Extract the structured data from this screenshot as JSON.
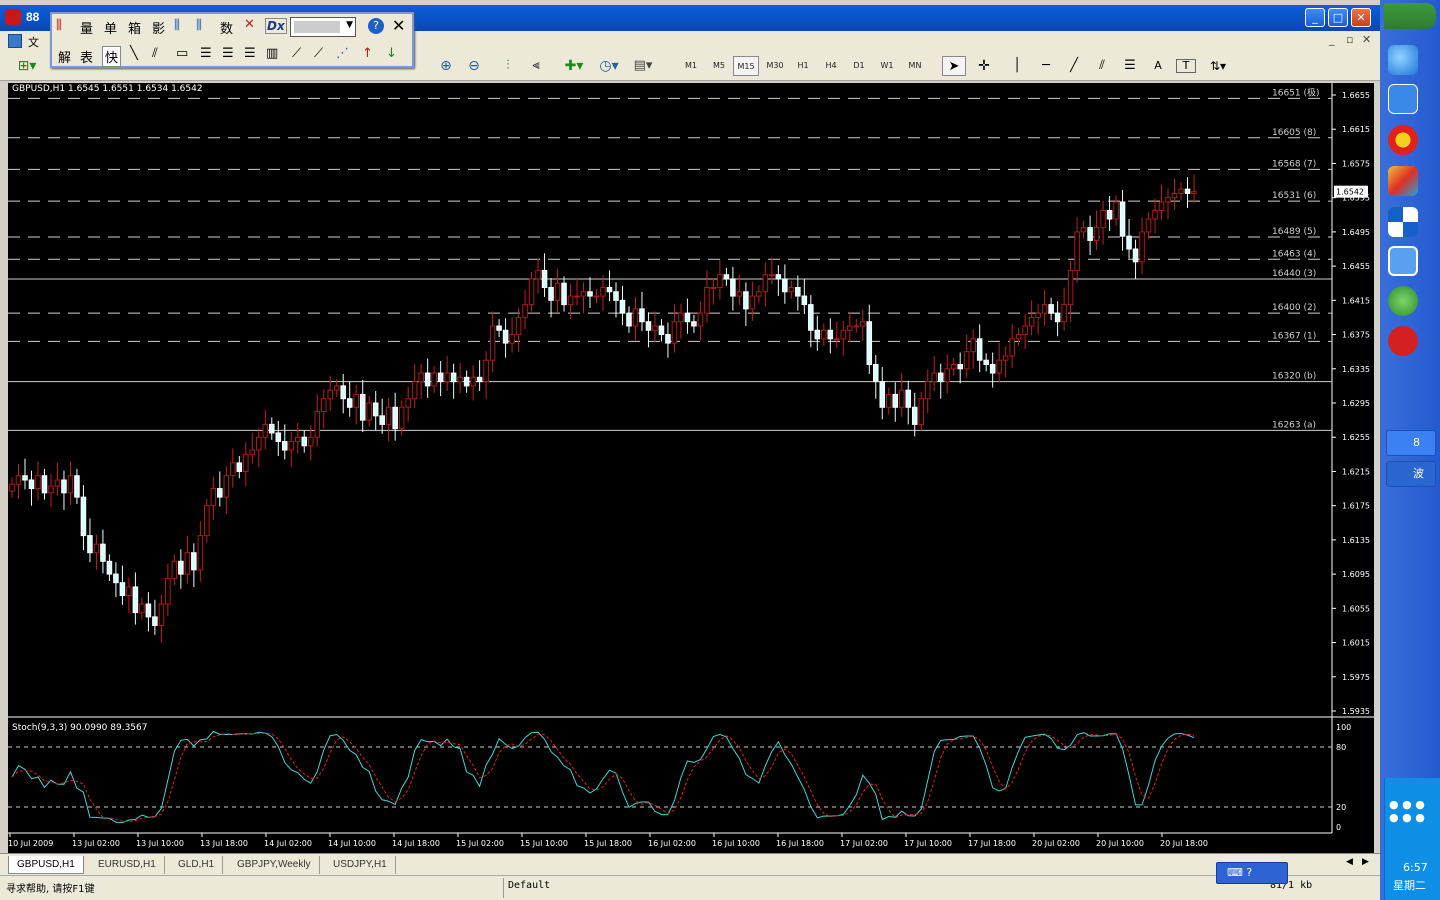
{
  "window": {
    "title": "88"
  },
  "menubar": {
    "items": [
      "文"
    ]
  },
  "float_toolbar": {
    "row1": [
      "量",
      "单",
      "箱",
      "影",
      "数",
      "Dx"
    ],
    "row2": [
      "解",
      "表",
      "快"
    ]
  },
  "toolbar": {
    "timeframes": [
      "M1",
      "M5",
      "M15",
      "M30",
      "H1",
      "H4",
      "D1",
      "W1",
      "MN"
    ],
    "active_timeframe": "M15",
    "tool_labels": [
      "A",
      "T"
    ]
  },
  "chart": {
    "symbol_info": "GBPUSD,H1  1.6545 1.6551 1.6534 1.6542",
    "price_axis": [
      "1.6655",
      "1.6615",
      "1.6575",
      "1.6535",
      "1.6495",
      "1.6455",
      "1.6415",
      "1.6375",
      "1.6335",
      "1.6295",
      "1.6255",
      "1.6215",
      "1.6175",
      "1.6135",
      "1.6095",
      "1.6055",
      "1.6015",
      "1.5975",
      "1.5935"
    ],
    "current_price": "1.6542",
    "levels": [
      {
        "label": "16651 (极)",
        "price": 1.6651,
        "style": "dash"
      },
      {
        "label": "16605 (8)",
        "price": 1.6605,
        "style": "dash"
      },
      {
        "label": "16568 (7)",
        "price": 1.6568,
        "style": "dash"
      },
      {
        "label": "16531 (6)",
        "price": 1.6531,
        "style": "dash"
      },
      {
        "label": "16489 (5)",
        "price": 1.6489,
        "style": "dash"
      },
      {
        "label": "16463 (4)",
        "price": 1.6463,
        "style": "dash"
      },
      {
        "label": "16440 (3)",
        "price": 1.644,
        "style": "solid"
      },
      {
        "label": "16400 (2)",
        "price": 1.64,
        "style": "dash"
      },
      {
        "label": "16367 (1)",
        "price": 1.6367,
        "style": "dash"
      },
      {
        "label": "16320 (b)",
        "price": 1.632,
        "style": "solid"
      },
      {
        "label": "16263 (a)",
        "price": 1.6263,
        "style": "solid"
      }
    ],
    "time_axis": [
      "10 Jul 2009",
      "13 Jul 02:00",
      "13 Jul 10:00",
      "13 Jul 18:00",
      "14 Jul 02:00",
      "14 Jul 10:00",
      "14 Jul 18:00",
      "15 Jul 02:00",
      "15 Jul 10:00",
      "15 Jul 18:00",
      "16 Jul 02:00",
      "16 Jul 10:00",
      "16 Jul 18:00",
      "17 Jul 02:00",
      "17 Jul 10:00",
      "17 Jul 18:00",
      "20 Jul 02:00",
      "20 Jul 10:00",
      "20 Jul 18:00"
    ],
    "indicator_label": "Stoch(9,3,3) 90.0990 89.3567",
    "indicator_axis": [
      "100",
      "80",
      "20",
      "0"
    ]
  },
  "chart_data": {
    "type": "candlestick",
    "symbol": "GBPUSD",
    "timeframe": "H1",
    "ylim": [
      1.5935,
      1.6655
    ],
    "closes": [
      1.62,
      1.621,
      1.6205,
      1.6195,
      1.621,
      1.619,
      1.6198,
      1.6205,
      1.619,
      1.621,
      1.6185,
      1.614,
      1.612,
      1.613,
      1.611,
      1.6095,
      1.6085,
      1.607,
      1.608,
      1.605,
      1.606,
      1.6045,
      1.6035,
      1.606,
      1.609,
      1.611,
      1.6095,
      1.612,
      1.61,
      1.614,
      1.6175,
      1.6195,
      1.6185,
      1.621,
      1.6225,
      1.6215,
      1.6235,
      1.624,
      1.6255,
      1.627,
      1.626,
      1.625,
      1.624,
      1.625,
      1.6255,
      1.6245,
      1.6255,
      1.6285,
      1.63,
      1.631,
      1.6315,
      1.63,
      1.629,
      1.6305,
      1.6275,
      1.6295,
      1.628,
      1.627,
      1.629,
      1.6265,
      1.629,
      1.63,
      1.632,
      1.633,
      1.6315,
      1.633,
      1.632,
      1.633,
      1.632,
      1.6325,
      1.6315,
      1.6325,
      1.632,
      1.6345,
      1.6385,
      1.638,
      1.6365,
      1.6375,
      1.6395,
      1.641,
      1.644,
      1.645,
      1.643,
      1.6415,
      1.6435,
      1.641,
      1.642,
      1.642,
      1.6425,
      1.642,
      1.642,
      1.643,
      1.6425,
      1.6415,
      1.64,
      1.6385,
      1.6405,
      1.639,
      1.638,
      1.6385,
      1.6375,
      1.6365,
      1.639,
      1.64,
      1.639,
      1.6385,
      1.64,
      1.643,
      1.643,
      1.6445,
      1.644,
      1.642,
      1.6425,
      1.6405,
      1.642,
      1.6425,
      1.6445,
      1.6445,
      1.644,
      1.6425,
      1.643,
      1.642,
      1.641,
      1.638,
      1.637,
      1.638,
      1.637,
      1.637,
      1.638,
      1.6385,
      1.6385,
      1.639,
      1.634,
      1.632,
      1.629,
      1.6305,
      1.629,
      1.631,
      1.629,
      1.627,
      1.63,
      1.632,
      1.633,
      1.632,
      1.6335,
      1.634,
      1.6335,
      1.6355,
      1.637,
      1.6345,
      1.634,
      1.633,
      1.6345,
      1.635,
      1.637,
      1.6375,
      1.6385,
      1.6395,
      1.64,
      1.641,
      1.64,
      1.639,
      1.641,
      1.645,
      1.6495,
      1.65,
      1.6485,
      1.65,
      1.652,
      1.651,
      1.653,
      1.649,
      1.6475,
      1.646,
      1.6495,
      1.651,
      1.652,
      1.653,
      1.6535,
      1.654,
      1.6545,
      1.654,
      1.6542
    ]
  },
  "tabs": {
    "items": [
      "GBPUSD,H1",
      "EURUSD,H1",
      "GLD,H1",
      "GBPJPY,Weekly",
      "USDJPY,H1"
    ],
    "active": "GBPUSD,H1"
  },
  "statusbar": {
    "help": "寻求帮助, 请按F1键",
    "profile": "Default",
    "connection": "81/1 kb"
  },
  "taskbar": {
    "tasks": [
      "8",
      "波"
    ],
    "clock_time": "6:57",
    "clock_day": "星期二"
  }
}
